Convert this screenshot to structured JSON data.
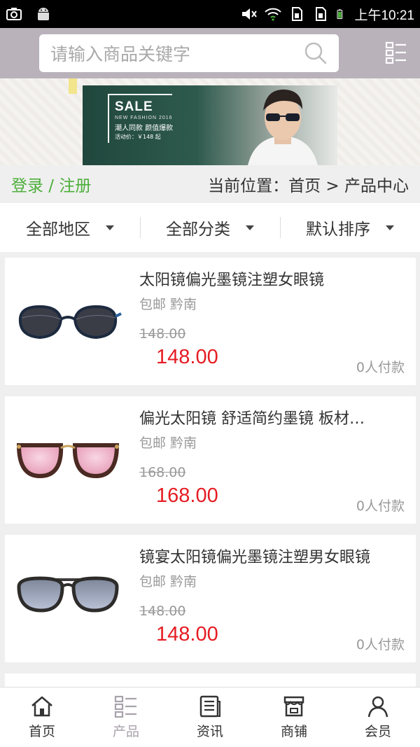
{
  "status_bar": {
    "time": "上午10:21",
    "icons": [
      "camera-icon",
      "android-icon",
      "mute-icon",
      "wifi-icon",
      "sim1-icon",
      "sim2-icon",
      "battery-icon"
    ]
  },
  "header": {
    "search_placeholder": "请输入商品关键字",
    "search_icon": "search-icon",
    "menu_icon": "list-menu-icon",
    "background_color": "#b9b2bb"
  },
  "banner": {
    "sale_text": "SALE",
    "subtitle_en": "NEW FASHION 2016",
    "subtitle_cn": "潮人同款 颜值爆款",
    "price_line": "活动价：￥148 起"
  },
  "breadcrumb": {
    "login_label": "登录 / 注册",
    "location_label": "当前位置：首页 > 产品中心"
  },
  "filters": [
    {
      "label": "全部地区"
    },
    {
      "label": "全部分类"
    },
    {
      "label": "默认排序"
    }
  ],
  "products": [
    {
      "title": "太阳镜偏光墨镜注塑女眼镜",
      "meta": "包邮 黔南",
      "old_price": "148.00",
      "price": "148.00",
      "sales": "0人付款",
      "image": "black-cateye-sunglasses"
    },
    {
      "title": "偏光太阳镜 舒适简约墨镜 板材…",
      "meta": "包邮 黔南",
      "old_price": "168.00",
      "price": "168.00",
      "sales": "0人付款",
      "image": "pink-mirror-sunglasses"
    },
    {
      "title": "镜宴太阳镜偏光墨镜注塑男女眼镜",
      "meta": "包邮 黔南",
      "old_price": "148.00",
      "price": "148.00",
      "sales": "0人付款",
      "image": "grey-aviator-sunglasses"
    }
  ],
  "bottom_nav": [
    {
      "label": "首页",
      "icon": "home-icon",
      "active": false
    },
    {
      "label": "产品",
      "icon": "product-list-icon",
      "active": true
    },
    {
      "label": "资讯",
      "icon": "news-icon",
      "active": false
    },
    {
      "label": "商铺",
      "icon": "shop-icon",
      "active": false
    },
    {
      "label": "会员",
      "icon": "member-icon",
      "active": false
    }
  ],
  "colors": {
    "price_red": "#e51c23",
    "login_green": "#4caf3a",
    "active_nav_gray": "#a8a2ab"
  }
}
